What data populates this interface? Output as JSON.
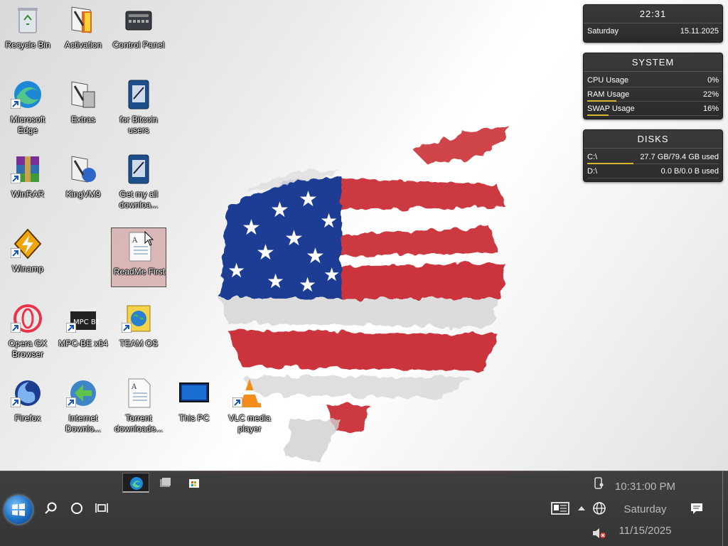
{
  "desktop": {
    "icons": [
      {
        "id": "recycle-bin",
        "label": "Recycle Bin",
        "icon": "recycle-bin-icon"
      },
      {
        "id": "activation",
        "label": "Activation",
        "icon": "activation-icon"
      },
      {
        "id": "control-panel",
        "label": "Control Panel",
        "icon": "control-panel-icon"
      },
      {
        "id": "microsoft-edge",
        "label": "Microsoft Edge",
        "icon": "edge-icon"
      },
      {
        "id": "extras",
        "label": "Extras",
        "icon": "extras-icon"
      },
      {
        "id": "for-bitcoin-users",
        "label": "for Bitcoin users",
        "icon": "document-icon"
      },
      {
        "id": "winrar",
        "label": "WinRAR",
        "icon": "winrar-icon"
      },
      {
        "id": "kingvm9",
        "label": "KingVM9",
        "icon": "kingvm-icon"
      },
      {
        "id": "get-my-all-downloads",
        "label": "Get my all downloa...",
        "icon": "document-icon"
      },
      {
        "id": "winamp",
        "label": "Winamp",
        "icon": "winamp-icon"
      },
      {
        "id": "readme-first",
        "label": "ReadMe First",
        "icon": "text-file-icon"
      },
      {
        "id": "opera-gx",
        "label": "Opera GX Browser",
        "icon": "opera-gx-icon"
      },
      {
        "id": "mpc-be",
        "label": "MPC-BE x64",
        "icon": "mpc-be-icon"
      },
      {
        "id": "team-os",
        "label": "TEAM OS",
        "icon": "globe-folder-icon"
      },
      {
        "id": "firefox",
        "label": "Firefox",
        "icon": "firefox-icon"
      },
      {
        "id": "internet-download",
        "label": "Internet Downlo...",
        "icon": "idm-icon"
      },
      {
        "id": "torrent-downloader",
        "label": "Torrent downloade...",
        "icon": "text-file-icon"
      },
      {
        "id": "this-pc",
        "label": "This PC",
        "icon": "monitor-icon"
      },
      {
        "id": "vlc",
        "label": "VLC media player",
        "icon": "vlc-icon"
      }
    ],
    "selected": "readme-first"
  },
  "widgets": {
    "clock": {
      "time": "22:31",
      "day": "Saturday",
      "date": "15.11.2025"
    },
    "system": {
      "title": "SYSTEM",
      "rows": [
        {
          "label": "CPU Usage",
          "value": "0%",
          "fraction": 0.0
        },
        {
          "label": "RAM Usage",
          "value": "22%",
          "fraction": 0.22
        },
        {
          "label": "SWAP Usage",
          "value": "16%",
          "fraction": 0.16
        }
      ]
    },
    "disks": {
      "title": "DISKS",
      "rows": [
        {
          "label": "C:\\",
          "value": "27.7 GB/79.4 GB used",
          "fraction": 0.35
        },
        {
          "label": "D:\\",
          "value": "0.0 B/0.0 B used",
          "fraction": 0.0
        }
      ]
    }
  },
  "taskbar": {
    "pinned": [
      {
        "name": "edge-icon",
        "active": true
      },
      {
        "name": "file-explorer-icon",
        "active": false
      },
      {
        "name": "store-icon",
        "active": false
      }
    ],
    "clock": {
      "time": "10:31:00 PM",
      "day": "Saturday",
      "date": "11/15/2025"
    },
    "accent": "#d9b534"
  }
}
